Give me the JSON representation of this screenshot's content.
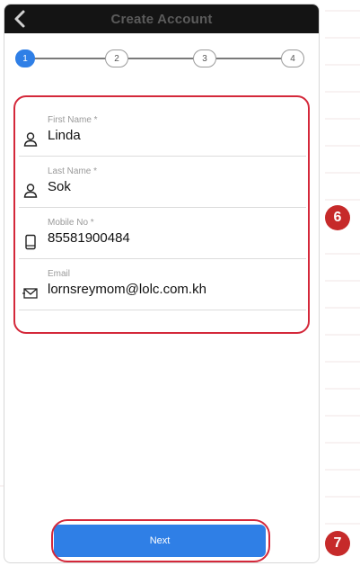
{
  "header": {
    "title": "Create Account"
  },
  "stepper": {
    "steps": [
      "1",
      "2",
      "3",
      "4"
    ],
    "active_step": 1
  },
  "form": {
    "fields": [
      {
        "label": "First Name *",
        "value": "Linda",
        "icon": "person-icon"
      },
      {
        "label": "Last Name *",
        "value": "Sok",
        "icon": "person-icon"
      },
      {
        "label": "Mobile No *",
        "value": "85581900484",
        "icon": "mobile-phone-icon"
      },
      {
        "label": "Email",
        "value": "lornsreymom@lolc.com.kh",
        "icon": "envelope-icon"
      }
    ]
  },
  "actions": {
    "next_label": "Next"
  },
  "annotations": {
    "badge_form": "6",
    "badge_next": "7"
  },
  "colors": {
    "accent": "#2f7fe6",
    "annotation": "#d4283a",
    "badge": "#c62a2a",
    "topbar": "#141414"
  }
}
